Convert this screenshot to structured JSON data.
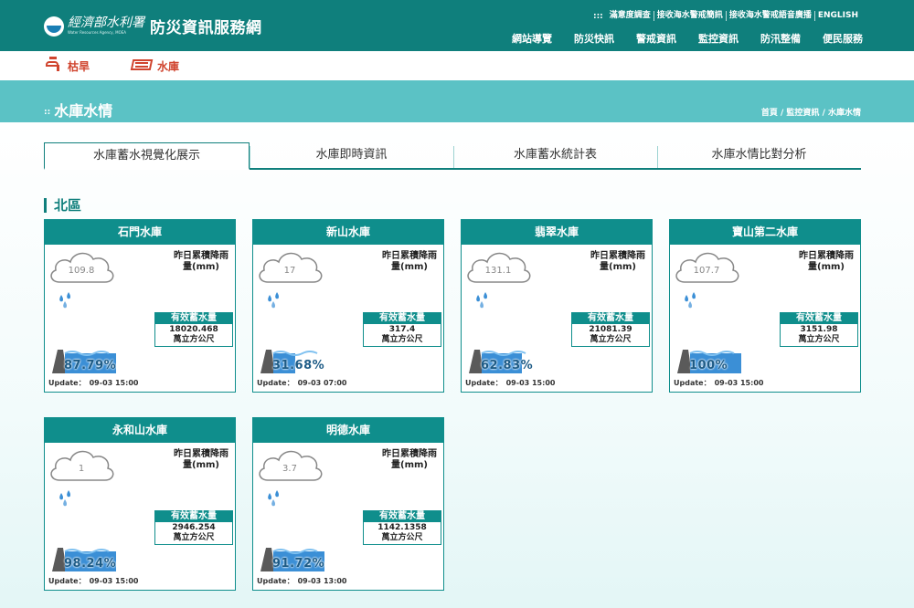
{
  "header": {
    "agency": "經濟部水利署",
    "agency_en": "Water Resources Agency, MOEA",
    "title": "防災資訊服務網",
    "util_links": [
      "滿意度調查",
      "接收海水警戒簡訊",
      "接收海水警戒語音廣播",
      "ENGLISH"
    ],
    "nav": [
      "網站導覽",
      "防災快訊",
      "警戒資訊",
      "監控資訊",
      "防汛整備",
      "便民服務"
    ]
  },
  "subnav": {
    "items": [
      {
        "label": "枯旱",
        "icon": "faucet-icon"
      },
      {
        "label": "水庫",
        "icon": "dam-icon"
      }
    ]
  },
  "band": {
    "title": "水庫水情",
    "breadcrumb": [
      "首頁",
      "監控資訊",
      "水庫水情"
    ]
  },
  "tabs": [
    "水庫蓄水視覺化展示",
    "水庫即時資訊",
    "水庫蓄水統計表",
    "水庫水情比對分析"
  ],
  "active_tab": 0,
  "region": "北區",
  "labels": {
    "rain_line1": "昨日累積降雨",
    "rain_line2": "量(mm)",
    "storage_title": "有效蓄水量",
    "storage_unit": "萬立方公尺",
    "update": "Update："
  },
  "reservoirs": [
    {
      "name": "石門水庫",
      "rain": "109.8",
      "storage": "18020.468",
      "percent": "87.79%",
      "fill": 0.8779,
      "update": "09-03 15:00"
    },
    {
      "name": "新山水庫",
      "rain": "17",
      "storage": "317.4",
      "percent": "31.68%",
      "fill": 0.3168,
      "update": "09-03 07:00"
    },
    {
      "name": "翡翠水庫",
      "rain": "131.1",
      "storage": "21081.39",
      "percent": "62.83%",
      "fill": 0.6283,
      "update": "09-03 15:00"
    },
    {
      "name": "寶山第二水庫",
      "rain": "107.7",
      "storage": "3151.98",
      "percent": "100%",
      "fill": 1.0,
      "update": "09-03 15:00"
    },
    {
      "name": "永和山水庫",
      "rain": "1",
      "storage": "2946.254",
      "percent": "98.24%",
      "fill": 0.9824,
      "update": "09-03 15:00"
    },
    {
      "name": "明德水庫",
      "rain": "3.7",
      "storage": "1142.1358",
      "percent": "91.72%",
      "fill": 0.9172,
      "update": "09-03 13:00"
    }
  ],
  "colors": {
    "primary": "#0f7f7c",
    "band": "#5bc2c5",
    "accent": "#d0442e",
    "water": "#3b8fd6"
  }
}
